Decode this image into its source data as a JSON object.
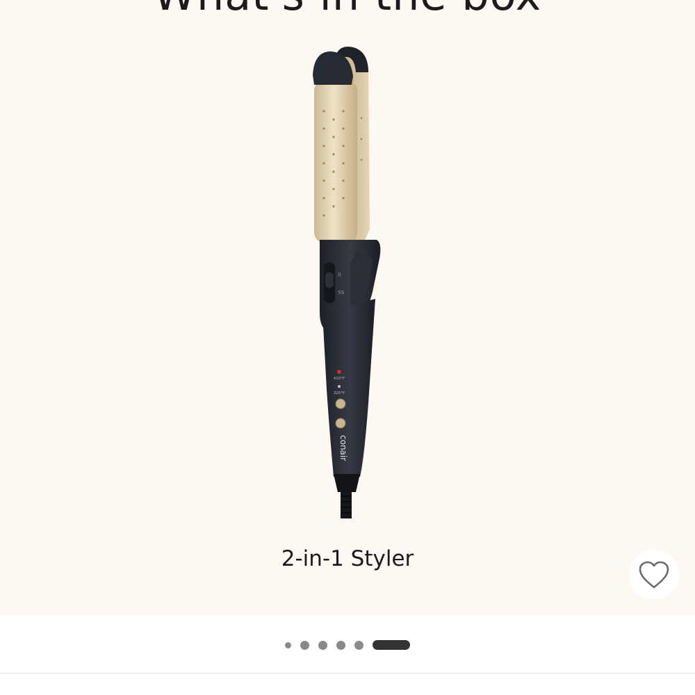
{
  "gallery": {
    "heading": "What's in the box",
    "caption": "2-in-1 Styler",
    "product": {
      "brand_mark": "conair",
      "temp_high": "410°F",
      "temp_low": "320°F"
    },
    "favorite_icon": "heart-outline-icon",
    "pagination": {
      "total": 6,
      "active_index": 5
    }
  },
  "colors": {
    "background": "#fdf8f1",
    "heading_text": "#1b1b1b",
    "active_dot": "#333333",
    "inactive_dot": "#8a8a8a"
  }
}
